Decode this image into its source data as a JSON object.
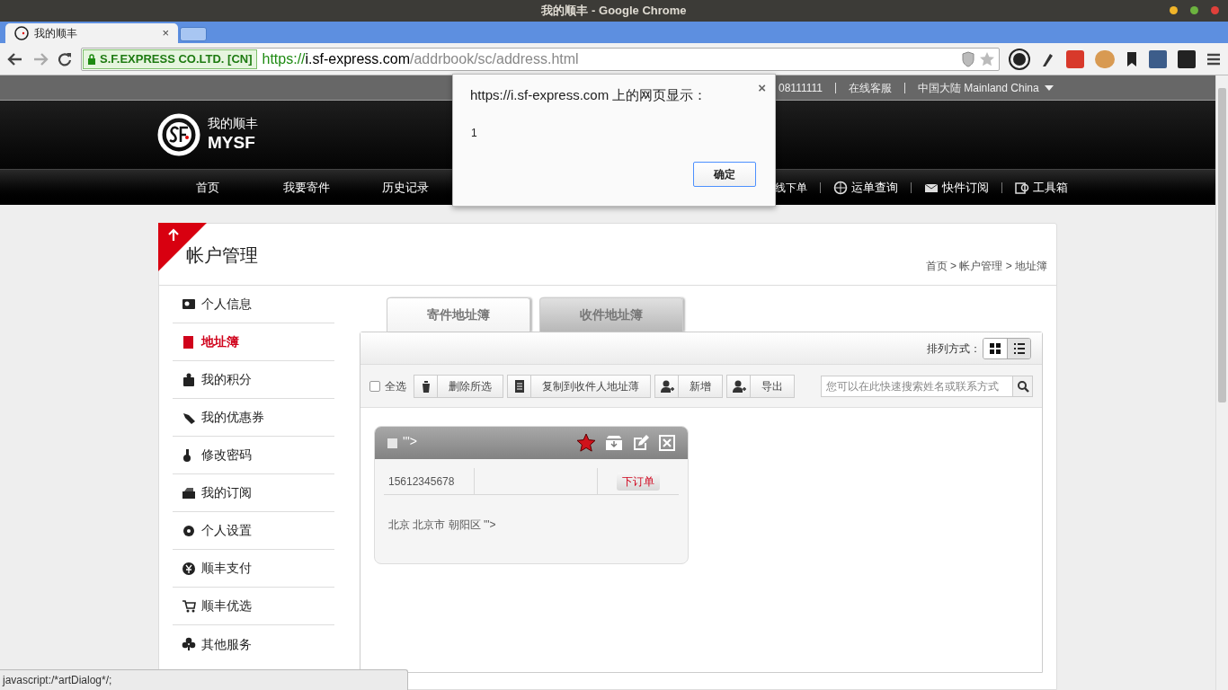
{
  "window": {
    "title": "我的顺丰 - Google Chrome"
  },
  "browser": {
    "tabs": [
      {
        "label": "我的顺丰",
        "selected": true,
        "close": "×"
      }
    ],
    "secure_label": "S.F.EXPRESS CO.LTD. [CN]",
    "url_scheme": "https://",
    "url_host": "i.sf-express.com",
    "url_path": "/addrbook/sc/address.html"
  },
  "top_links": [
    "08111111",
    "在线客服",
    "中国大陆 Mainland China"
  ],
  "logo": {
    "cn": "我的顺丰",
    "en": "MYSF"
  },
  "nav": [
    {
      "label": "首页",
      "kind": "plain"
    },
    {
      "label": "我要寄件",
      "kind": "plain"
    },
    {
      "label": "历史记录",
      "kind": "plain"
    },
    {
      "label": "线下单",
      "kind": "cut"
    },
    {
      "label": "运单查询",
      "kind": "icon"
    },
    {
      "label": "快件订阅",
      "kind": "icon"
    },
    {
      "label": "工具箱",
      "kind": "icon"
    }
  ],
  "page": {
    "title": "帐户管理",
    "breadcrumb": "首页 > 帐户管理 > 地址簿"
  },
  "sidebar": {
    "items": [
      {
        "label": "个人信息",
        "selected": false
      },
      {
        "label": "地址簿",
        "selected": true
      },
      {
        "label": "我的积分",
        "selected": false
      },
      {
        "label": "我的优惠券",
        "selected": false
      },
      {
        "label": "修改密码",
        "selected": false
      },
      {
        "label": "我的订阅",
        "selected": false
      },
      {
        "label": "个人设置",
        "selected": false
      },
      {
        "label": "顺丰支付",
        "selected": false
      },
      {
        "label": "顺丰优选",
        "selected": false
      },
      {
        "label": "其他服务",
        "selected": false
      }
    ]
  },
  "tabs": [
    {
      "label": "寄件地址簿",
      "selected": true
    },
    {
      "label": "收件地址簿",
      "selected": false
    }
  ],
  "sort": {
    "label": "排列方式：",
    "views": [
      {
        "kind": "grid",
        "selected": true
      },
      {
        "kind": "list",
        "selected": false
      }
    ]
  },
  "toolbar": {
    "select_all": {
      "label": "全选",
      "checked": false
    },
    "buttons": [
      {
        "label": "删除所选",
        "kind": "trash"
      },
      {
        "label": "复制到收件人地址薄",
        "kind": "doc"
      },
      {
        "label": "新增",
        "kind": "user"
      },
      {
        "label": "导出",
        "kind": "user"
      }
    ],
    "search": {
      "placeholder": "您可以在此快速搜索姓名或联系方式"
    }
  },
  "contacts": [
    {
      "name": "'\">",
      "checked": false,
      "starred": true,
      "phone": "15612345678",
      "order_button": "下订单",
      "address": "北京 北京市 朝阳区 '\">"
    }
  ],
  "dialog": {
    "title": "https://i.sf-express.com 上的网页显示：",
    "message": "1",
    "close": "×",
    "ok": "确定"
  },
  "status_bubble": "javascript:/*artDialog*/;"
}
